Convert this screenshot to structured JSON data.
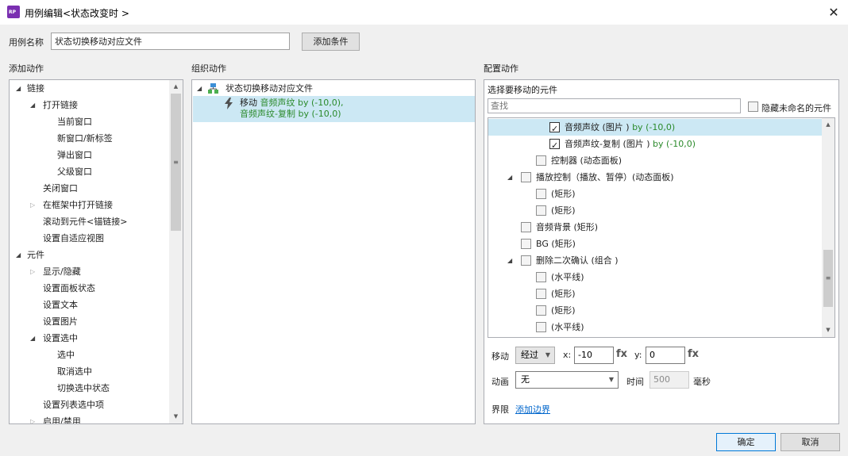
{
  "window": {
    "title": "用例编辑<状态改变时 >",
    "icon_text": "RP",
    "close_glyph": "✕"
  },
  "case_name": {
    "label": "用例名称",
    "value": "状态切换移动对应文件",
    "add_condition_label": "添加条件"
  },
  "add_actions": {
    "header": "添加动作",
    "items": [
      {
        "label": "链接",
        "level": 0,
        "arrow": "down"
      },
      {
        "label": "打开链接",
        "level": 1,
        "arrow": "down"
      },
      {
        "label": "当前窗口",
        "level": 2,
        "arrow": ""
      },
      {
        "label": "新窗口/新标签",
        "level": 2,
        "arrow": ""
      },
      {
        "label": "弹出窗口",
        "level": 2,
        "arrow": ""
      },
      {
        "label": "父级窗口",
        "level": 2,
        "arrow": ""
      },
      {
        "label": "关闭窗口",
        "level": 1,
        "arrow": ""
      },
      {
        "label": "在框架中打开链接",
        "level": 1,
        "arrow": "right"
      },
      {
        "label": "滚动到元件<锚链接>",
        "level": 1,
        "arrow": ""
      },
      {
        "label": "设置自适应视图",
        "level": 1,
        "arrow": ""
      },
      {
        "label": "元件",
        "level": 0,
        "arrow": "down"
      },
      {
        "label": "显示/隐藏",
        "level": 1,
        "arrow": "right"
      },
      {
        "label": "设置面板状态",
        "level": 1,
        "arrow": ""
      },
      {
        "label": "设置文本",
        "level": 1,
        "arrow": ""
      },
      {
        "label": "设置图片",
        "level": 1,
        "arrow": ""
      },
      {
        "label": "设置选中",
        "level": 1,
        "arrow": "down"
      },
      {
        "label": "选中",
        "level": 2,
        "arrow": ""
      },
      {
        "label": "取消选中",
        "level": 2,
        "arrow": ""
      },
      {
        "label": "切换选中状态",
        "level": 2,
        "arrow": ""
      },
      {
        "label": "设置列表选中项",
        "level": 1,
        "arrow": ""
      },
      {
        "label": "启用/禁用",
        "level": 1,
        "arrow": "right"
      }
    ]
  },
  "organize_actions": {
    "header": "组织动作",
    "case_label": "状态切换移动对应文件",
    "action": {
      "verb": "移动",
      "line1_target": "音频声纹 by (-10,0),",
      "line2_target": "音频声纹-复制 by (-10,0)"
    }
  },
  "configure_actions": {
    "header": "配置动作",
    "choose_label": "选择要移动的元件",
    "search_placeholder": "查找",
    "hide_unnamed_label": "隐藏未命名的元件",
    "widgets": [
      {
        "name": "音频声纹 (图片 )",
        "extra": " by (-10,0)",
        "level": 3,
        "checked": true,
        "arrow": "",
        "selected": true
      },
      {
        "name": "音频声纹-复制 (图片 )",
        "extra": " by (-10,0)",
        "level": 3,
        "checked": true,
        "arrow": "",
        "selected": false
      },
      {
        "name": "控制器 (动态面板)",
        "extra": "",
        "level": 2,
        "checked": false,
        "arrow": "",
        "selected": false
      },
      {
        "name": "播放控制（播放、暂停）(动态面板)",
        "extra": "",
        "level": 1,
        "checked": false,
        "arrow": "down",
        "selected": false
      },
      {
        "name": "(矩形)",
        "extra": "",
        "level": 2,
        "checked": false,
        "arrow": "",
        "selected": false
      },
      {
        "name": "(矩形)",
        "extra": "",
        "level": 2,
        "checked": false,
        "arrow": "",
        "selected": false
      },
      {
        "name": "音频背景 (矩形)",
        "extra": "",
        "level": 1,
        "checked": false,
        "arrow": "",
        "selected": false
      },
      {
        "name": "BG (矩形)",
        "extra": "",
        "level": 1,
        "checked": false,
        "arrow": "",
        "selected": false
      },
      {
        "name": "删除二次确认 (组合 )",
        "extra": "",
        "level": 1,
        "checked": false,
        "arrow": "down",
        "selected": false
      },
      {
        "name": "(水平线)",
        "extra": "",
        "level": 2,
        "checked": false,
        "arrow": "",
        "selected": false
      },
      {
        "name": "(矩形)",
        "extra": "",
        "level": 2,
        "checked": false,
        "arrow": "",
        "selected": false
      },
      {
        "name": "(矩形)",
        "extra": "",
        "level": 2,
        "checked": false,
        "arrow": "",
        "selected": false
      },
      {
        "name": "(水平线)",
        "extra": "",
        "level": 2,
        "checked": false,
        "arrow": "",
        "selected": false
      }
    ],
    "move": {
      "label": "移动",
      "mode": "经过",
      "x_label": "x:",
      "x_value": "-10",
      "y_label": "y:",
      "y_value": "0",
      "fx": "fx"
    },
    "animation": {
      "label": "动画",
      "value": "无",
      "time_label": "时间",
      "time_value": "500",
      "unit": "毫秒"
    },
    "bounds": {
      "label": "界限",
      "link": "添加边界"
    }
  },
  "footer": {
    "ok_label": "确定",
    "cancel_label": "取消"
  }
}
